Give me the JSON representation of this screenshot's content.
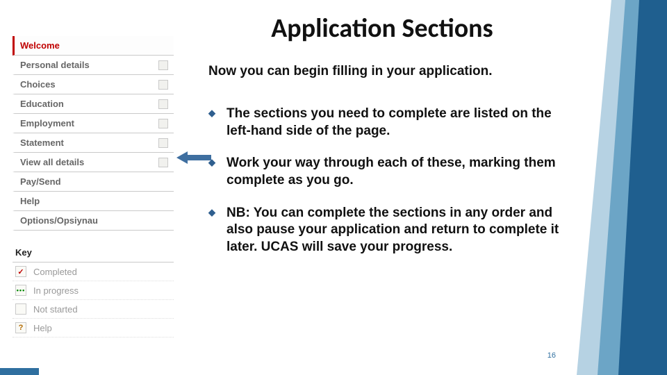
{
  "title": "Application Sections",
  "intro": "Now you can begin filling in your application.",
  "bullets": [
    "The sections you need to complete are listed on the left-hand side of the page.",
    "Work your way through each of these, marking them complete as you go.",
    "NB: You can complete the sections in any order and also pause your application and return to complete it later.  UCAS will save your progress."
  ],
  "sidebar": {
    "items": [
      {
        "label": "Welcome",
        "active": true,
        "checkbox": false
      },
      {
        "label": "Personal details",
        "active": false,
        "checkbox": true
      },
      {
        "label": "Choices",
        "active": false,
        "checkbox": true
      },
      {
        "label": "Education",
        "active": false,
        "checkbox": true
      },
      {
        "label": "Employment",
        "active": false,
        "checkbox": true
      },
      {
        "label": "Statement",
        "active": false,
        "checkbox": true
      },
      {
        "label": "View all details",
        "active": false,
        "checkbox": true
      },
      {
        "label": "Pay/Send",
        "active": false,
        "checkbox": false
      },
      {
        "label": "Help",
        "active": false,
        "checkbox": false
      },
      {
        "label": "Options/Opsiynau",
        "active": false,
        "checkbox": false
      }
    ]
  },
  "key": {
    "title": "Key",
    "rows": [
      {
        "icon_glyph": "✓",
        "icon_class": "completed",
        "label": "Completed"
      },
      {
        "icon_glyph": "•••",
        "icon_class": "progress",
        "label": "In progress"
      },
      {
        "icon_glyph": " ",
        "icon_class": "notstarted",
        "label": "Not started"
      },
      {
        "icon_glyph": "?",
        "icon_class": "help",
        "label": "Help"
      }
    ]
  },
  "slide_number": "16"
}
